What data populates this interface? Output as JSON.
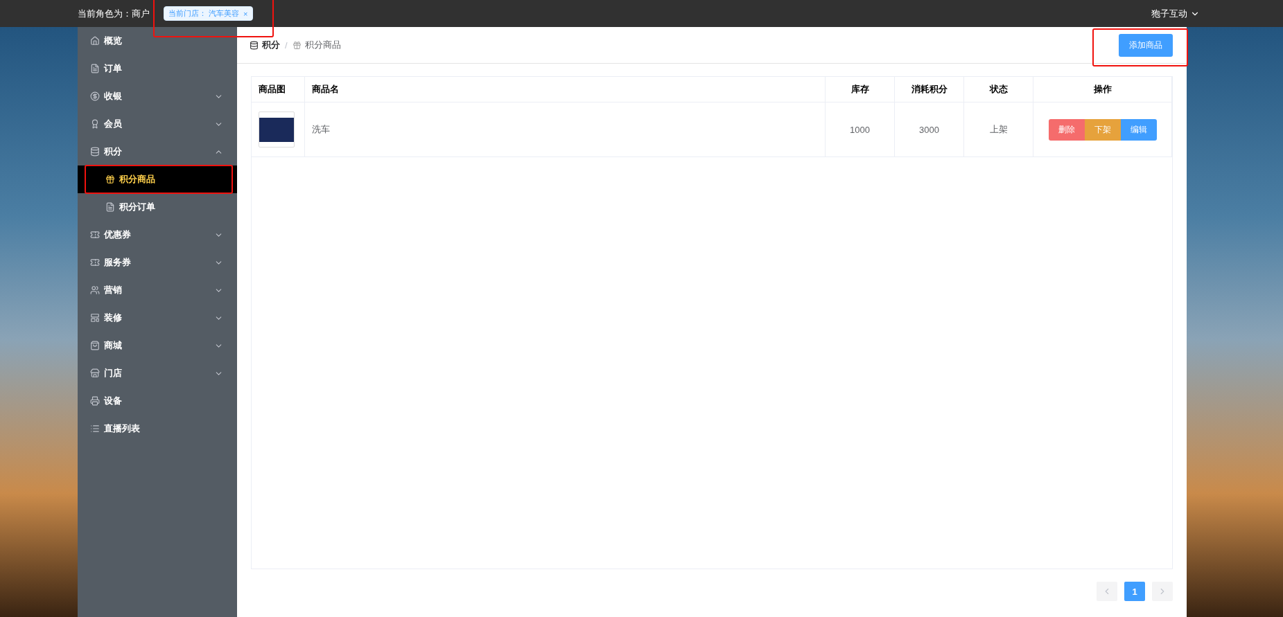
{
  "topbar": {
    "role_label": "当前角色为：商户",
    "store_tag": {
      "label": "当前门店： 汽车美容",
      "close": "×",
      "highlighted": true
    },
    "user": "狍子互动"
  },
  "sidebar": {
    "items": [
      {
        "label": "概览",
        "kind": "link",
        "selected": false
      },
      {
        "label": "订单",
        "kind": "link",
        "selected": false
      },
      {
        "label": "收银",
        "kind": "group",
        "expanded": false,
        "selected": false
      },
      {
        "label": "会员",
        "kind": "group",
        "expanded": false,
        "selected": false
      },
      {
        "label": "积分",
        "kind": "group",
        "expanded": true,
        "selected": false,
        "children": [
          {
            "label": "积分商品",
            "selected": true,
            "highlighted": true
          },
          {
            "label": "积分订单",
            "selected": false,
            "highlighted": false
          }
        ]
      },
      {
        "label": "优惠券",
        "kind": "group",
        "expanded": false,
        "selected": false
      },
      {
        "label": "服务券",
        "kind": "group",
        "expanded": false,
        "selected": false
      },
      {
        "label": "营销",
        "kind": "group",
        "expanded": false,
        "selected": false
      },
      {
        "label": "装修",
        "kind": "group",
        "expanded": false,
        "selected": false
      },
      {
        "label": "商城",
        "kind": "group",
        "expanded": false,
        "selected": false
      },
      {
        "label": "门店",
        "kind": "group",
        "expanded": false,
        "selected": false
      },
      {
        "label": "设备",
        "kind": "link",
        "selected": false
      },
      {
        "label": "直播列表",
        "kind": "link",
        "selected": false
      }
    ]
  },
  "breadcrumb": {
    "separator": "/",
    "items": [
      "积分",
      "积分商品"
    ]
  },
  "add_button": {
    "label": "添加商品",
    "highlighted": true
  },
  "table": {
    "columns": [
      "商品图",
      "商品名",
      "库存",
      "消耗积分",
      "状态",
      "操作"
    ],
    "rows": [
      {
        "name": "洗车",
        "stock": "1000",
        "points": "3000",
        "status": "上架",
        "actions": [
          {
            "label": "删除",
            "kind": "danger"
          },
          {
            "label": "下架",
            "kind": "warning"
          },
          {
            "label": "编辑",
            "kind": "primary"
          }
        ]
      }
    ]
  },
  "pagination": {
    "pages": [
      {
        "label": "1",
        "selected": true
      }
    ]
  }
}
